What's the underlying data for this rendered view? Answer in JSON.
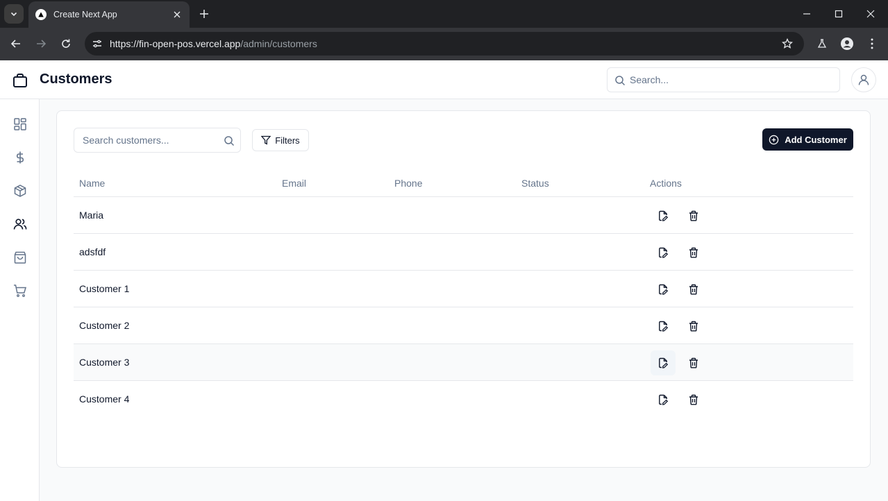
{
  "browser": {
    "tab_title": "Create Next App",
    "url_host": "https://fin-open-pos.vercel.app",
    "url_path": "/admin/customers"
  },
  "header": {
    "title": "Customers",
    "search_placeholder": "Search..."
  },
  "sidebar": {
    "items": [
      {
        "name": "dashboard",
        "icon": "layout-dashboard-icon"
      },
      {
        "name": "cashier",
        "icon": "dollar-sign-icon"
      },
      {
        "name": "products",
        "icon": "package-icon"
      },
      {
        "name": "customers",
        "icon": "users-icon",
        "active": true
      },
      {
        "name": "orders",
        "icon": "shopping-bag-icon"
      },
      {
        "name": "pos",
        "icon": "shopping-cart-icon"
      }
    ]
  },
  "toolbar": {
    "search_placeholder": "Search customers...",
    "filters_label": "Filters",
    "add_label": "Add Customer"
  },
  "table": {
    "columns": [
      "Name",
      "Email",
      "Phone",
      "Status",
      "Actions"
    ],
    "rows": [
      {
        "name": "Maria",
        "email": "",
        "phone": "",
        "status": ""
      },
      {
        "name": "adsfdf",
        "email": "",
        "phone": "",
        "status": ""
      },
      {
        "name": "Customer 1",
        "email": "",
        "phone": "",
        "status": ""
      },
      {
        "name": "Customer 2",
        "email": "",
        "phone": "",
        "status": ""
      },
      {
        "name": "Customer 3",
        "email": "",
        "phone": "",
        "status": ""
      },
      {
        "name": "Customer 4",
        "email": "",
        "phone": "",
        "status": ""
      }
    ]
  },
  "colors": {
    "primary": "#0f172a",
    "muted": "#64748b",
    "border": "#e5e7eb"
  }
}
